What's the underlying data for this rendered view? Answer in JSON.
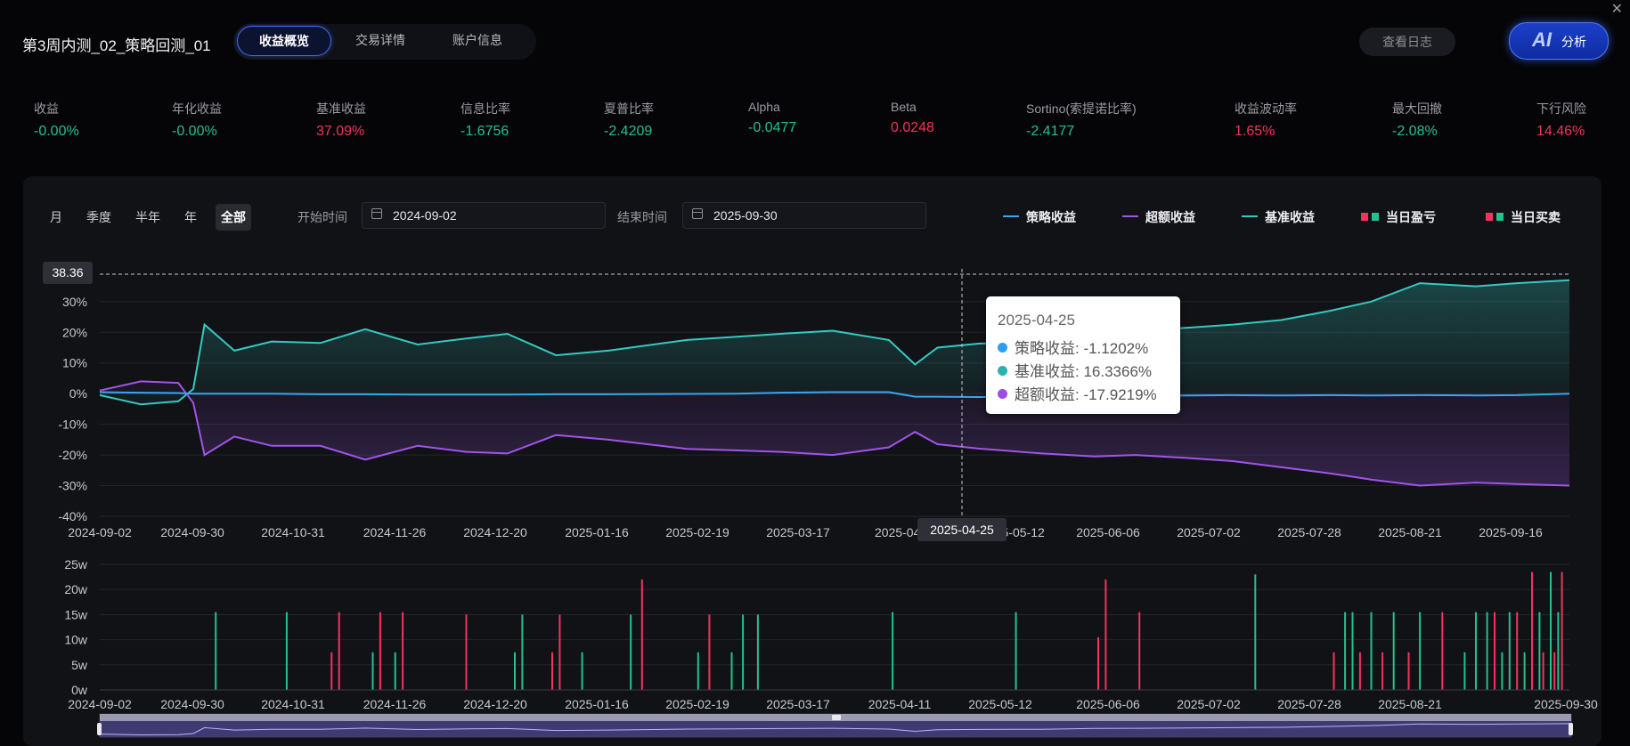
{
  "header": {
    "title": "第3周内测_02_策略回测_01",
    "tabs": [
      {
        "label": "收益概览",
        "active": true
      },
      {
        "label": "交易详情",
        "active": false
      },
      {
        "label": "账户信息",
        "active": false
      }
    ],
    "log_button": "查看日志",
    "ai_glyph": "AI",
    "ai_button": "分析"
  },
  "metrics": [
    {
      "label": "收益",
      "value": "-0.00%",
      "color": "green"
    },
    {
      "label": "年化收益",
      "value": "-0.00%",
      "color": "green"
    },
    {
      "label": "基准收益",
      "value": "37.09%",
      "color": "red"
    },
    {
      "label": "信息比率",
      "value": "-1.6756",
      "color": "green"
    },
    {
      "label": "夏普比率",
      "value": "-2.4209",
      "color": "green"
    },
    {
      "label": "Alpha",
      "value": "-0.0477",
      "color": "green"
    },
    {
      "label": "Beta",
      "value": "0.0248",
      "color": "red"
    },
    {
      "label": "Sortino(索提诺比率)",
      "value": "-2.4177",
      "color": "green"
    },
    {
      "label": "收益波动率",
      "value": "1.65%",
      "color": "red"
    },
    {
      "label": "最大回撤",
      "value": "-2.08%",
      "color": "green"
    },
    {
      "label": "下行风险",
      "value": "14.46%",
      "color": "red"
    }
  ],
  "controls": {
    "periods": [
      {
        "label": "月",
        "active": false
      },
      {
        "label": "季度",
        "active": false
      },
      {
        "label": "半年",
        "active": false
      },
      {
        "label": "年",
        "active": false
      },
      {
        "label": "全部",
        "active": true
      }
    ],
    "start_label": "开始时间",
    "start_date": "2024-09-02",
    "end_label": "结束时间",
    "end_date": "2025-09-30"
  },
  "legend": [
    {
      "label": "策略收益",
      "type": "line",
      "color": "#3aa6f0"
    },
    {
      "label": "超额收益",
      "type": "line",
      "color": "#a155e8"
    },
    {
      "label": "基准收益",
      "type": "line",
      "color": "#35c9c0"
    },
    {
      "label": "当日盈亏",
      "type": "bars",
      "colors": [
        "#f2335d",
        "#21c28b"
      ]
    },
    {
      "label": "当日买卖",
      "type": "bars",
      "colors": [
        "#f2335d",
        "#21c28b"
      ]
    }
  ],
  "colors": {
    "strategy": "#3aa6f0",
    "excess": "#a155e8",
    "benchmark": "#35c9c0",
    "up": "#f2335d",
    "down": "#21c28b"
  },
  "tooltip": {
    "date": "2025-04-25",
    "rows": [
      {
        "label": "策略收益: -1.1202%",
        "color": "#2b9ef0"
      },
      {
        "label": "基准收益: 16.3366%",
        "color": "#2bb3b0"
      },
      {
        "label": "超额收益: -17.9219%",
        "color": "#9b4fe0"
      }
    ]
  },
  "crosshair": {
    "y_value_label": "38.36",
    "x_date_label": "2025-04-25"
  },
  "chart_data": [
    {
      "type": "line",
      "x_ticks": [
        "2024-09-02",
        "2024-09-30",
        "2024-10-31",
        "2024-11-26",
        "2024-12-20",
        "2025-01-16",
        "2025-02-19",
        "2025-03-17",
        "2025-04-",
        "2025-05-12",
        "2025-06-06",
        "2025-07-02",
        "2025-07-28",
        "2025-08-21",
        "2025-09-16"
      ],
      "y_ticks": [
        "30%",
        "20%",
        "10%",
        "0%",
        "-10%",
        "-20%",
        "-30%",
        "-40%"
      ],
      "ylim": [
        -40,
        38.36
      ],
      "x": [
        "2024-09-02",
        "2024-09-13",
        "2024-09-23",
        "2024-09-27",
        "2024-09-30",
        "2024-10-08",
        "2024-10-18",
        "2024-10-31",
        "2024-11-12",
        "2024-11-26",
        "2024-12-09",
        "2024-12-20",
        "2025-01-02",
        "2025-01-16",
        "2025-02-06",
        "2025-02-19",
        "2025-03-03",
        "2025-03-17",
        "2025-04-01",
        "2025-04-08",
        "2025-04-14",
        "2025-04-25",
        "2025-05-12",
        "2025-05-26",
        "2025-06-06",
        "2025-06-20",
        "2025-07-02",
        "2025-07-15",
        "2025-07-28",
        "2025-08-08",
        "2025-08-21",
        "2025-09-05",
        "2025-09-16",
        "2025-09-30"
      ],
      "series": [
        {
          "name": "基准收益",
          "values": [
            -0.5,
            -3.5,
            -2.5,
            1.5,
            22.5,
            14,
            17,
            16.5,
            21,
            16,
            18,
            19.5,
            12.5,
            14,
            17.5,
            18.5,
            19.5,
            20.5,
            17.5,
            9.5,
            15,
            16.3,
            17,
            20,
            20.5,
            21.5,
            22.5,
            24,
            27,
            30,
            36,
            35,
            36,
            37
          ]
        },
        {
          "name": "超额收益",
          "values": [
            1,
            4,
            3.5,
            -3,
            -20,
            -14,
            -17,
            -17,
            -21.5,
            -17,
            -19,
            -19.5,
            -13.5,
            -15,
            -18,
            -18.5,
            -19,
            -20,
            -17.5,
            -12.5,
            -16.5,
            -17.9,
            -19.5,
            -20.5,
            -20,
            -21,
            -22,
            -24,
            -26,
            -28,
            -30,
            -29,
            -29.5,
            -30
          ]
        },
        {
          "name": "策略收益",
          "values": [
            0.5,
            0.3,
            0.2,
            0,
            0,
            0,
            0,
            -0.2,
            -0.2,
            -0.3,
            -0.3,
            -0.3,
            -0.2,
            -0.2,
            -0.1,
            0,
            0.3,
            0.5,
            0.5,
            -1,
            -1,
            -1.1,
            -1,
            -0.8,
            -0.7,
            -0.6,
            -0.5,
            -0.6,
            -0.5,
            -0.6,
            -0.5,
            -0.6,
            -0.5,
            0
          ]
        }
      ]
    },
    {
      "type": "bar",
      "x_ticks": [
        "2024-09-02",
        "2024-09-30",
        "2024-10-31",
        "2024-11-26",
        "2024-12-20",
        "2025-01-16",
        "2025-02-19",
        "2025-03-17",
        "2025-04-11",
        "2025-05-12",
        "2025-06-06",
        "2025-07-02",
        "2025-07-28",
        "2025-08-21",
        "2025-09-30"
      ],
      "y_ticks": [
        "25w",
        "20w",
        "15w",
        "10w",
        "5w",
        "0w"
      ],
      "ylim": [
        0,
        25
      ],
      "bars": [
        {
          "date": "2024-10-03",
          "value": 15.5,
          "color": "green"
        },
        {
          "date": "2024-10-22",
          "value": 15.5,
          "color": "green"
        },
        {
          "date": "2024-11-03",
          "value": 7.5,
          "color": "red"
        },
        {
          "date": "2024-11-05",
          "value": 15.5,
          "color": "red"
        },
        {
          "date": "2024-11-14",
          "value": 7.5,
          "color": "green"
        },
        {
          "date": "2024-11-16",
          "value": 15.5,
          "color": "red"
        },
        {
          "date": "2024-11-20",
          "value": 7.5,
          "color": "green"
        },
        {
          "date": "2024-11-22",
          "value": 15.5,
          "color": "red"
        },
        {
          "date": "2024-12-09",
          "value": 15,
          "color": "red"
        },
        {
          "date": "2024-12-22",
          "value": 7.5,
          "color": "green"
        },
        {
          "date": "2024-12-24",
          "value": 15,
          "color": "green"
        },
        {
          "date": "2025-01-01",
          "value": 7.5,
          "color": "red"
        },
        {
          "date": "2025-01-03",
          "value": 15,
          "color": "red"
        },
        {
          "date": "2025-01-09",
          "value": 7.5,
          "color": "green"
        },
        {
          "date": "2025-01-22",
          "value": 15,
          "color": "green"
        },
        {
          "date": "2025-01-25",
          "value": 22,
          "color": "red"
        },
        {
          "date": "2025-02-09",
          "value": 7.5,
          "color": "green"
        },
        {
          "date": "2025-02-12",
          "value": 15,
          "color": "red"
        },
        {
          "date": "2025-02-18",
          "value": 7.5,
          "color": "green"
        },
        {
          "date": "2025-02-21",
          "value": 15,
          "color": "green"
        },
        {
          "date": "2025-02-25",
          "value": 15,
          "color": "green"
        },
        {
          "date": "2025-04-02",
          "value": 15.5,
          "color": "green"
        },
        {
          "date": "2025-05-05",
          "value": 15.5,
          "color": "green"
        },
        {
          "date": "2025-05-27",
          "value": 10.5,
          "color": "red"
        },
        {
          "date": "2025-05-29",
          "value": 22,
          "color": "red"
        },
        {
          "date": "2025-06-07",
          "value": 15.5,
          "color": "red"
        },
        {
          "date": "2025-07-08",
          "value": 23,
          "color": "green"
        },
        {
          "date": "2025-07-29",
          "value": 7.5,
          "color": "red"
        },
        {
          "date": "2025-08-01",
          "value": 15.5,
          "color": "green"
        },
        {
          "date": "2025-08-03",
          "value": 15.5,
          "color": "green"
        },
        {
          "date": "2025-08-05",
          "value": 7.5,
          "color": "red"
        },
        {
          "date": "2025-08-08",
          "value": 15.5,
          "color": "green"
        },
        {
          "date": "2025-08-11",
          "value": 7.5,
          "color": "red"
        },
        {
          "date": "2025-08-14",
          "value": 15.5,
          "color": "green"
        },
        {
          "date": "2025-08-18",
          "value": 7.5,
          "color": "red"
        },
        {
          "date": "2025-08-21",
          "value": 15.5,
          "color": "green"
        },
        {
          "date": "2025-08-27",
          "value": 15.5,
          "color": "red"
        },
        {
          "date": "2025-09-02",
          "value": 7.5,
          "color": "green"
        },
        {
          "date": "2025-09-05",
          "value": 15.5,
          "color": "green"
        },
        {
          "date": "2025-09-08",
          "value": 15.5,
          "color": "green"
        },
        {
          "date": "2025-09-10",
          "value": 15.5,
          "color": "red"
        },
        {
          "date": "2025-09-12",
          "value": 7.5,
          "color": "green"
        },
        {
          "date": "2025-09-14",
          "value": 15.5,
          "color": "green"
        },
        {
          "date": "2025-09-16",
          "value": 15.5,
          "color": "red"
        },
        {
          "date": "2025-09-18",
          "value": 7.5,
          "color": "green"
        },
        {
          "date": "2025-09-20",
          "value": 23.5,
          "color": "red"
        },
        {
          "date": "2025-09-22",
          "value": 15.5,
          "color": "green"
        },
        {
          "date": "2025-09-23",
          "value": 7.5,
          "color": "red"
        },
        {
          "date": "2025-09-25",
          "value": 23.5,
          "color": "green"
        },
        {
          "date": "2025-09-26",
          "value": 7.5,
          "color": "red"
        },
        {
          "date": "2025-09-27",
          "value": 15.5,
          "color": "green"
        },
        {
          "date": "2025-09-28",
          "value": 23.5,
          "color": "red"
        }
      ]
    }
  ]
}
